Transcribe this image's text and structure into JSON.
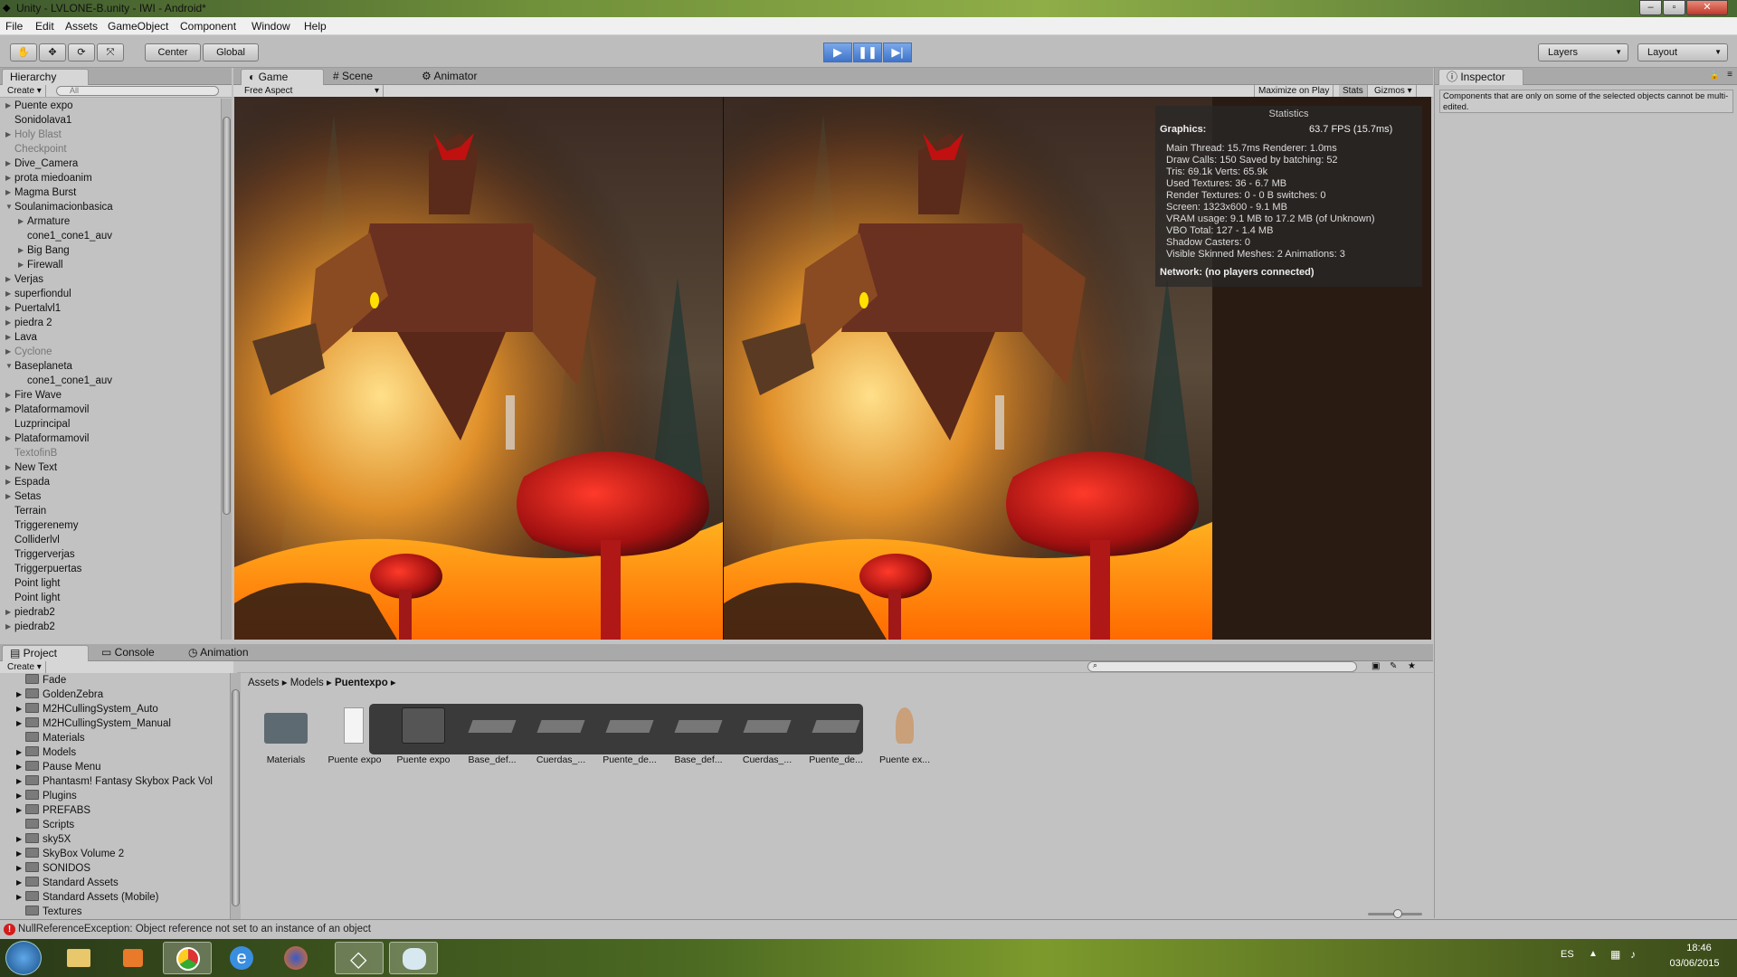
{
  "window": {
    "title": "Unity - LVLONE-B.unity - IWI - Android*"
  },
  "menu": [
    "File",
    "Edit",
    "Assets",
    "GameObject",
    "Component",
    "Window",
    "Help"
  ],
  "toolbar": {
    "center_label": "Center",
    "global_label": "Global",
    "layers_label": "Layers",
    "layout_label": "Layout"
  },
  "hierarchy": {
    "tab": "Hierarchy",
    "create": "Create",
    "search_placeholder": "All",
    "items": [
      {
        "label": "Puente expo",
        "indent": 0,
        "arrow": "right",
        "dim": false
      },
      {
        "label": "Sonidolava1",
        "indent": 0,
        "arrow": "",
        "dim": false
      },
      {
        "label": "Holy Blast",
        "indent": 0,
        "arrow": "right",
        "dim": true
      },
      {
        "label": "Checkpoint",
        "indent": 0,
        "arrow": "",
        "dim": true
      },
      {
        "label": "Dive_Camera",
        "indent": 0,
        "arrow": "right",
        "dim": false
      },
      {
        "label": "prota miedoanim",
        "indent": 0,
        "arrow": "right",
        "dim": false
      },
      {
        "label": "Magma Burst",
        "indent": 0,
        "arrow": "right",
        "dim": false
      },
      {
        "label": "Soulanimacionbasica",
        "indent": 0,
        "arrow": "down",
        "dim": false
      },
      {
        "label": "Armature",
        "indent": 1,
        "arrow": "right",
        "dim": false
      },
      {
        "label": "cone1_cone1_auv",
        "indent": 1,
        "arrow": "",
        "dim": false
      },
      {
        "label": "Big Bang",
        "indent": 1,
        "arrow": "right",
        "dim": false
      },
      {
        "label": "Firewall",
        "indent": 1,
        "arrow": "right",
        "dim": false
      },
      {
        "label": "Verjas",
        "indent": 0,
        "arrow": "right",
        "dim": false
      },
      {
        "label": "superfiondul",
        "indent": 0,
        "arrow": "right",
        "dim": false
      },
      {
        "label": "Puertalvl1",
        "indent": 0,
        "arrow": "right",
        "dim": false
      },
      {
        "label": "piedra 2",
        "indent": 0,
        "arrow": "right",
        "dim": false
      },
      {
        "label": "Lava",
        "indent": 0,
        "arrow": "right",
        "dim": false
      },
      {
        "label": "Cyclone",
        "indent": 0,
        "arrow": "right",
        "dim": true
      },
      {
        "label": "Baseplaneta",
        "indent": 0,
        "arrow": "down",
        "dim": false
      },
      {
        "label": "cone1_cone1_auv",
        "indent": 1,
        "arrow": "",
        "dim": false
      },
      {
        "label": "Fire Wave",
        "indent": 0,
        "arrow": "right",
        "dim": false
      },
      {
        "label": "Plataformamovil",
        "indent": 0,
        "arrow": "right",
        "dim": false
      },
      {
        "label": "Luzprincipal",
        "indent": 0,
        "arrow": "",
        "dim": false
      },
      {
        "label": "Plataformamovil",
        "indent": 0,
        "arrow": "right",
        "dim": false
      },
      {
        "label": "TextofinB",
        "indent": 0,
        "arrow": "",
        "dim": true
      },
      {
        "label": "New Text",
        "indent": 0,
        "arrow": "right",
        "dim": false
      },
      {
        "label": "Espada",
        "indent": 0,
        "arrow": "right",
        "dim": false
      },
      {
        "label": "Setas",
        "indent": 0,
        "arrow": "right",
        "dim": false
      },
      {
        "label": "Terrain",
        "indent": 0,
        "arrow": "",
        "dim": false
      },
      {
        "label": "Triggerenemy",
        "indent": 0,
        "arrow": "",
        "dim": false
      },
      {
        "label": "Colliderlvl",
        "indent": 0,
        "arrow": "",
        "dim": false
      },
      {
        "label": "Triggerverjas",
        "indent": 0,
        "arrow": "",
        "dim": false
      },
      {
        "label": "Triggerpuertas",
        "indent": 0,
        "arrow": "",
        "dim": false
      },
      {
        "label": "Point light",
        "indent": 0,
        "arrow": "",
        "dim": false
      },
      {
        "label": "Point light",
        "indent": 0,
        "arrow": "",
        "dim": false
      },
      {
        "label": "piedrab2",
        "indent": 0,
        "arrow": "right",
        "dim": false
      },
      {
        "label": "piedrab2",
        "indent": 0,
        "arrow": "right",
        "dim": false
      }
    ]
  },
  "center_tabs": {
    "game": "Game",
    "scene": "Scene",
    "animator": "Animator"
  },
  "game": {
    "aspect": "Free Aspect",
    "maximize": "Maximize on Play",
    "stats": "Stats",
    "gizmos": "Gizmos"
  },
  "statistics": {
    "header": "Statistics",
    "graphics_label": "Graphics:",
    "fps": "63.7 FPS (15.7ms)",
    "lines": [
      "Main Thread: 15.7ms  Renderer: 1.0ms",
      "Draw Calls: 150   Saved by batching: 52",
      "Tris: 69.1k   Verts: 65.9k",
      "Used Textures: 36 - 6.7 MB",
      "Render Textures: 0 - 0 B   switches: 0",
      "Screen: 1323x600 - 9.1 MB",
      "VRAM usage: 9.1 MB to 17.2 MB (of Unknown)",
      "VBO Total: 127 - 1.4 MB",
      "Shadow Casters: 0",
      "Visible Skinned Meshes: 2     Animations: 3"
    ],
    "network": "Network: (no players connected)"
  },
  "inspector": {
    "tab": "Inspector",
    "message": "Components that are only on some of the selected objects cannot be multi-edited."
  },
  "bottom_tabs": {
    "project": "Project",
    "console": "Console",
    "animation": "Animation"
  },
  "project": {
    "create": "Create",
    "folders": [
      {
        "label": "Fade",
        "arrow": false
      },
      {
        "label": "GoldenZebra",
        "arrow": true
      },
      {
        "label": "M2HCullingSystem_Auto",
        "arrow": true
      },
      {
        "label": "M2HCullingSystem_Manual",
        "arrow": true
      },
      {
        "label": "Materials",
        "arrow": false
      },
      {
        "label": "Models",
        "arrow": true
      },
      {
        "label": "Pause Menu",
        "arrow": true
      },
      {
        "label": "Phantasm! Fantasy Skybox Pack Vol",
        "arrow": true
      },
      {
        "label": "Plugins",
        "arrow": true
      },
      {
        "label": "PREFABS",
        "arrow": true
      },
      {
        "label": "Scripts",
        "arrow": false
      },
      {
        "label": "sky5X",
        "arrow": true
      },
      {
        "label": "SkyBox Volume 2",
        "arrow": true
      },
      {
        "label": "SONIDOS",
        "arrow": true
      },
      {
        "label": "Standard Assets",
        "arrow": true
      },
      {
        "label": "Standard Assets (Mobile)",
        "arrow": true
      },
      {
        "label": "Textures",
        "arrow": false
      }
    ],
    "breadcrumb": [
      "Assets",
      "Models",
      "Puentexpo"
    ],
    "assets": [
      {
        "label": "Materials",
        "icon": "folder-icon"
      },
      {
        "label": "Puente expo",
        "icon": "file-icon"
      },
      {
        "label": "Puente expo",
        "icon": "mesh-prefab-icon"
      },
      {
        "label": "Base_def...",
        "icon": "mesh-icon"
      },
      {
        "label": "Cuerdas_...",
        "icon": "mesh-icon"
      },
      {
        "label": "Puente_de...",
        "icon": "mesh-icon"
      },
      {
        "label": "Base_def...",
        "icon": "mesh-icon"
      },
      {
        "label": "Cuerdas_...",
        "icon": "mesh-icon"
      },
      {
        "label": "Puente_de...",
        "icon": "mesh-icon"
      },
      {
        "label": "Puente ex...",
        "icon": "avatar-icon"
      }
    ]
  },
  "status": {
    "error": "NullReferenceException: Object reference not set to an instance of an object"
  },
  "taskbar": {
    "lang": "ES",
    "time": "18:46",
    "date": "03/06/2015"
  }
}
